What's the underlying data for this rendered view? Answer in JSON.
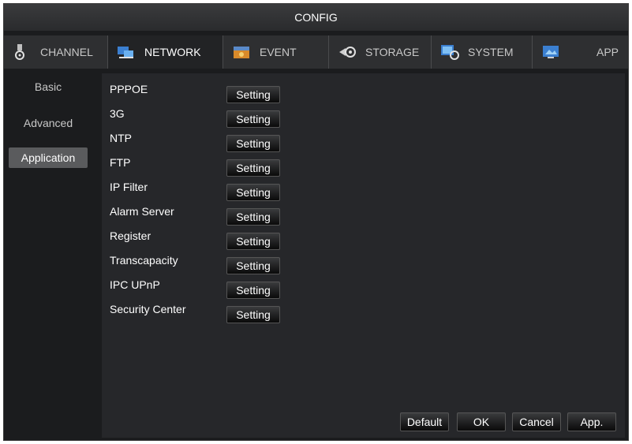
{
  "window": {
    "title": "CONFIG"
  },
  "tabs": [
    {
      "label": "CHANNEL",
      "icon": "channel-icon",
      "active": false
    },
    {
      "label": "NETWORK",
      "icon": "network-icon",
      "active": true
    },
    {
      "label": "EVENT",
      "icon": "event-icon",
      "active": false
    },
    {
      "label": "STORAGE",
      "icon": "storage-icon",
      "active": false
    },
    {
      "label": "SYSTEM",
      "icon": "system-icon",
      "active": false
    },
    {
      "label": "APP",
      "icon": "app-icon",
      "active": false
    }
  ],
  "sidebar": {
    "items": [
      {
        "label": "Basic",
        "active": false
      },
      {
        "label": "Advanced",
        "active": false
      },
      {
        "label": "Application",
        "active": true
      }
    ]
  },
  "main": {
    "setting_label": "Setting",
    "rows": [
      {
        "label": "PPPOE"
      },
      {
        "label": "3G"
      },
      {
        "label": "NTP"
      },
      {
        "label": "FTP"
      },
      {
        "label": "IP Filter"
      },
      {
        "label": "Alarm Server"
      },
      {
        "label": "Register"
      },
      {
        "label": "Transcapacity"
      },
      {
        "label": "IPC UPnP"
      },
      {
        "label": "Security Center"
      }
    ]
  },
  "footer": {
    "default_label": "Default",
    "ok_label": "OK",
    "cancel_label": "Cancel",
    "apply_label": "App."
  },
  "colors": {
    "background": "#1b1c1e",
    "panel": "#26272a",
    "active_item": "#5a5b5d"
  }
}
